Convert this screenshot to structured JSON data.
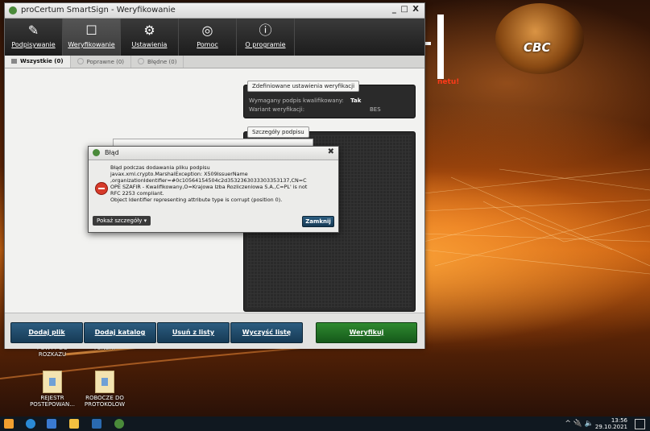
{
  "window": {
    "title": "proCertum SmartSign - Weryfikowanie",
    "controls": "_ □ X"
  },
  "toolbar": [
    {
      "label": "Podpisywanie",
      "icon": "sign-icon"
    },
    {
      "label": "Weryfikowanie",
      "icon": "verify-icon",
      "active": true
    },
    {
      "label": "Ustawienia",
      "icon": "gear-icon"
    },
    {
      "label": "Pomoc",
      "icon": "help-lifebuoy-icon"
    },
    {
      "label": "O programie",
      "icon": "info-icon"
    }
  ],
  "tabs": [
    {
      "label": "Wszystkie (0)",
      "active": true
    },
    {
      "label": "Poprawne (0)"
    },
    {
      "label": "Błędne (0)"
    }
  ],
  "settings_panel": {
    "title": "Zdefiniowane ustawienia weryfikacji",
    "rows": [
      {
        "label": "Wymagany podpis kwalifikowany:",
        "value": "Tak"
      },
      {
        "label": "Wariant weryfikacji:",
        "value": "BES"
      }
    ]
  },
  "details_panel": {
    "title": "Szczegóły podpisu"
  },
  "buttons": {
    "add_file": "Dodaj plik",
    "add_dir": "Dodaj katalog",
    "remove": "Usuń z listy",
    "clear": "Wyczyść listę",
    "verify": "Weryfikuj"
  },
  "dialog": {
    "title": "Błąd",
    "message_lines": [
      "Błąd podczas dodawania pliku podpisu",
      "javax.xml.crypto.MarshalException: X509IssuerName",
      ",organizationIdentifier=#0c10564154504c2d3532363033303353137,CN=C",
      "OPE SZAFIR - Kwalifikowany,O=Krajowa Izba Rozliczeniowa S.A.,C=PL' is not",
      "RFC 2253 compliant.",
      "Object Identifier representing attribute type is corrupt (position 0)."
    ],
    "details_label": "Pokaż szczegóły ▾",
    "close_label": "Zamknij"
  },
  "desktop": {
    "brand": "CBC",
    "red_text": "netu!",
    "icons": [
      {
        "label": "POWTT DO\nROZKAZU"
      },
      {
        "label": "TONERY"
      },
      {
        "label": "REJESTR\nPOSTEPOWAN..."
      },
      {
        "label": "ROBOCZE DO\nPROTOKOLOW"
      }
    ]
  },
  "taskbar": {
    "time": "13:56",
    "date": "29.10.2021",
    "tray": "^ 🔌 🔈"
  }
}
